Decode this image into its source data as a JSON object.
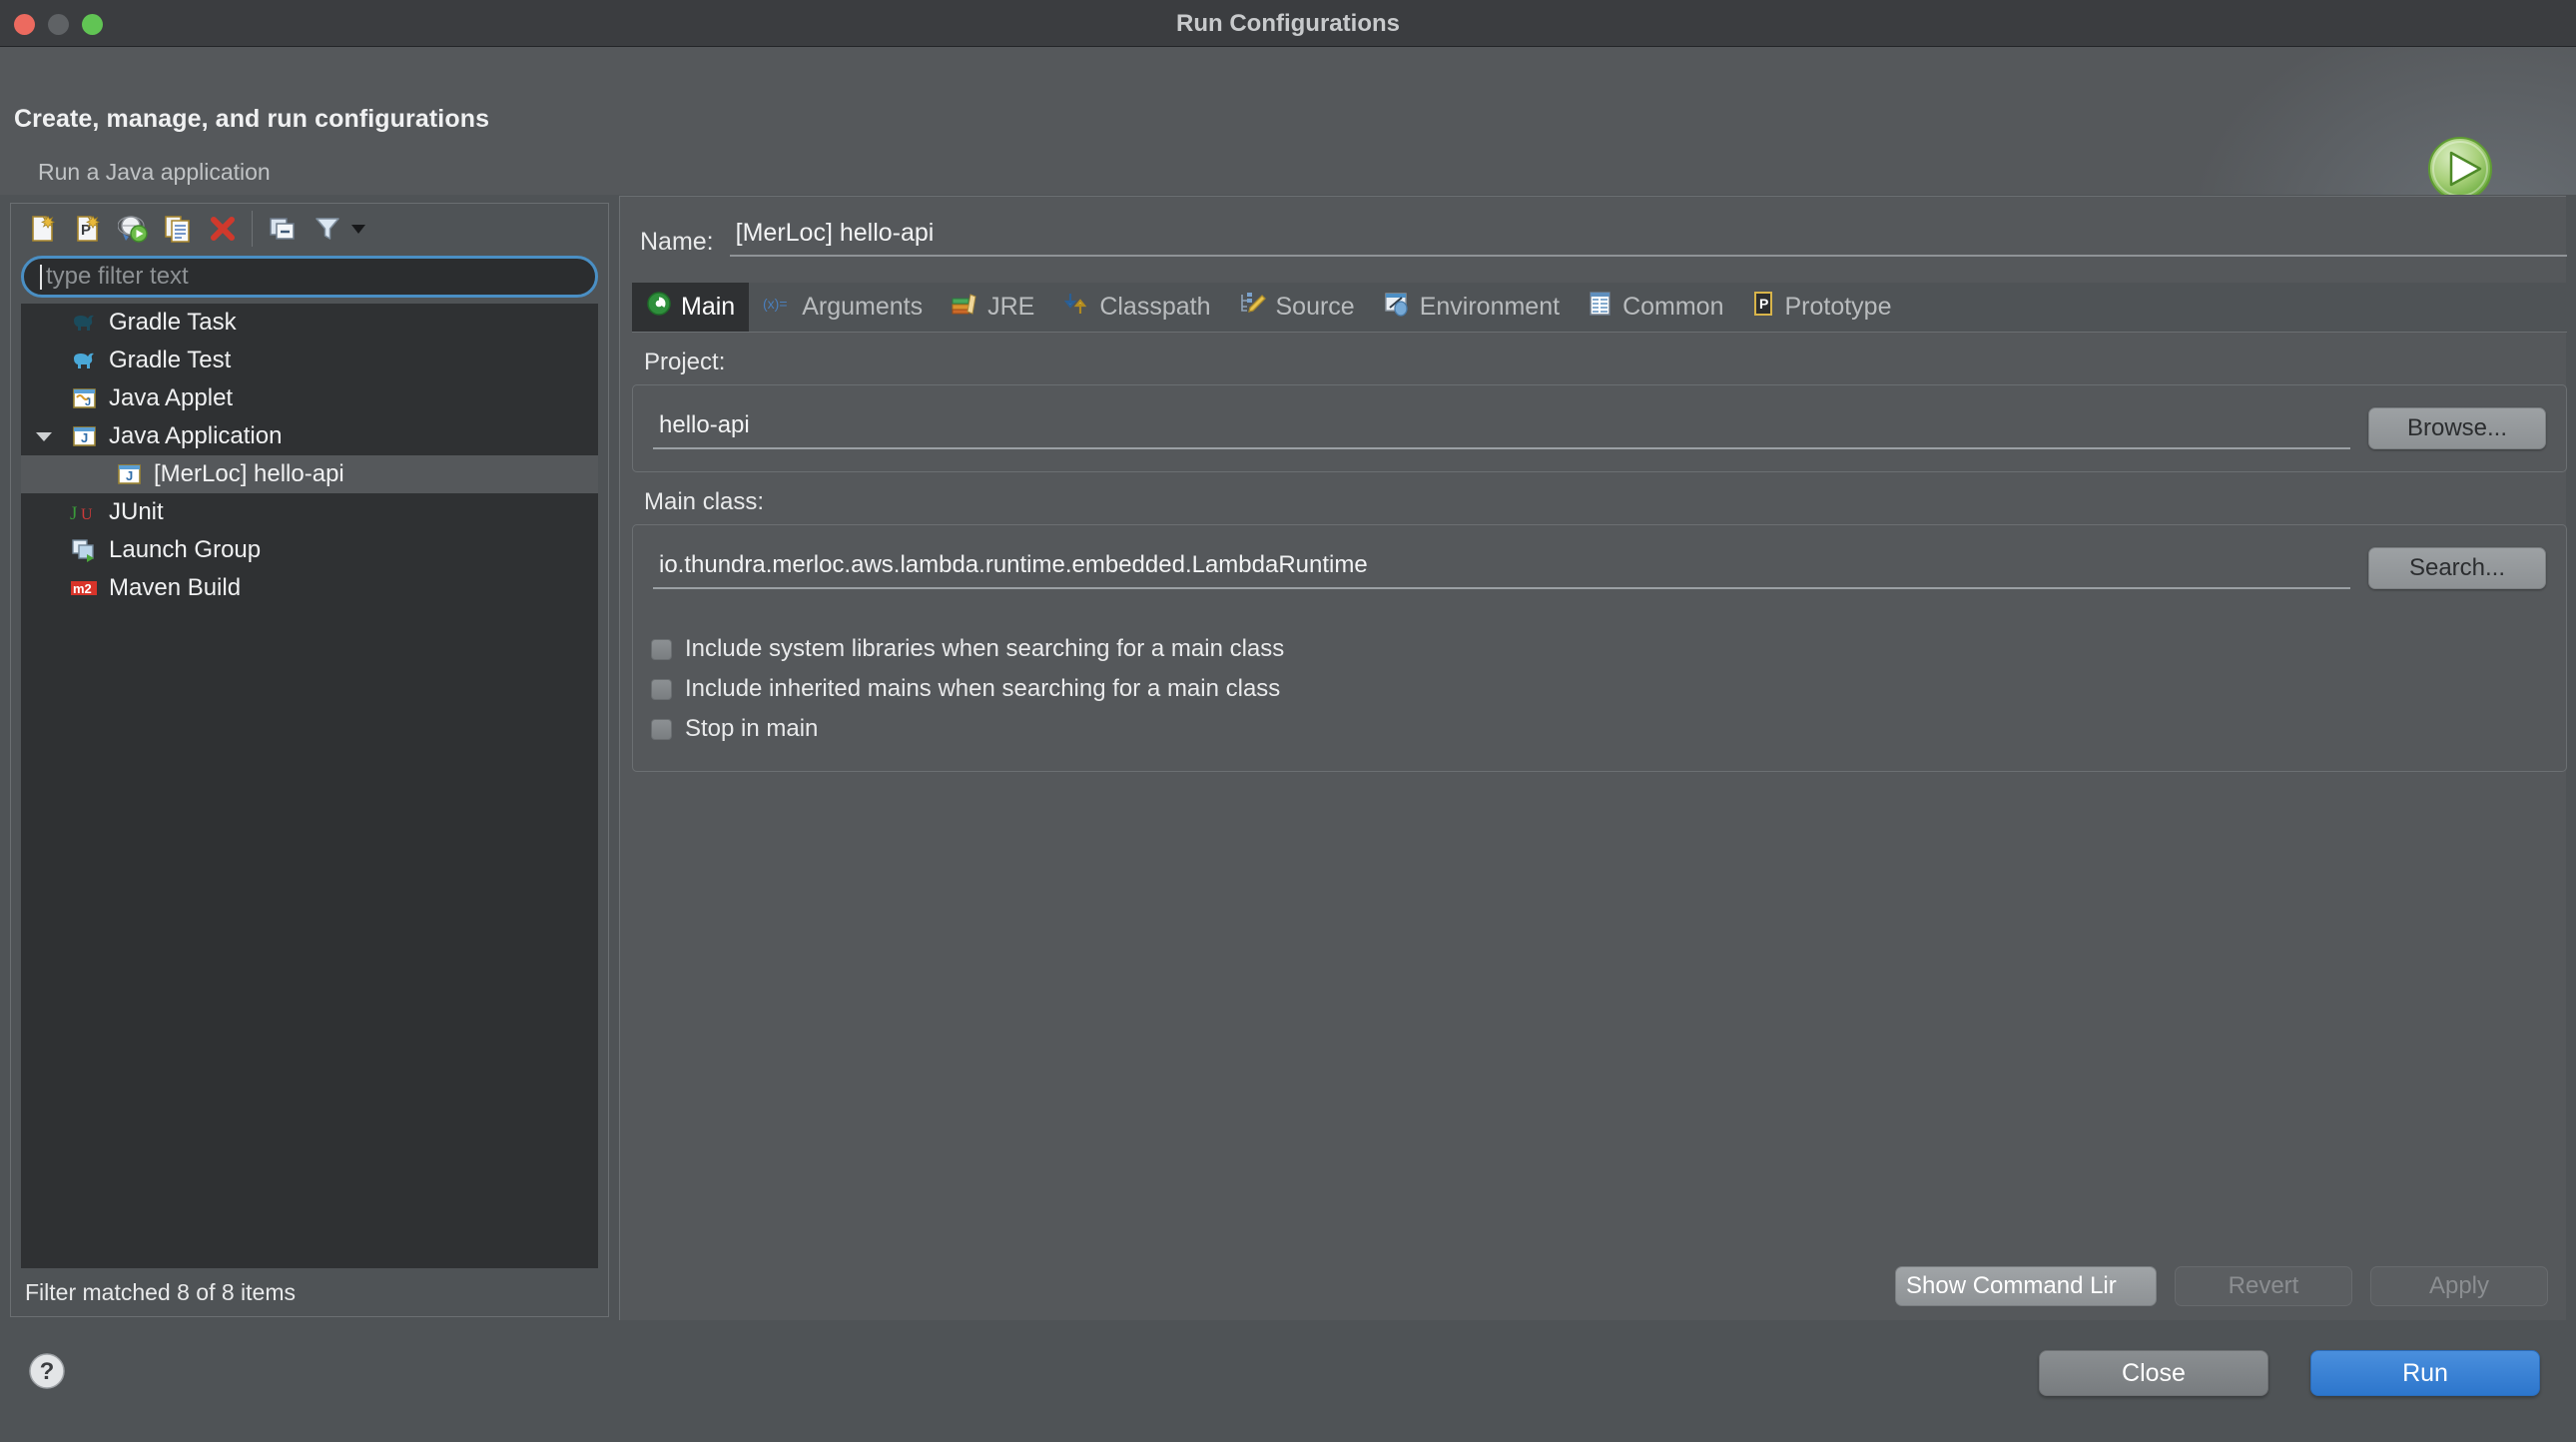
{
  "window": {
    "title": "Run Configurations",
    "traffic_lights": [
      "close",
      "minimize",
      "maximize"
    ]
  },
  "header": {
    "title": "Create, manage, and run configurations",
    "subtitle": "Run a Java application",
    "icon": "run-green-play-icon"
  },
  "left_panel": {
    "toolbar": [
      {
        "name": "new-configuration-icon",
        "tooltip": "New launch configuration"
      },
      {
        "name": "new-prototype-icon",
        "tooltip": "New prototype"
      },
      {
        "name": "export-configuration-icon",
        "tooltip": "Export"
      },
      {
        "name": "duplicate-configuration-icon",
        "tooltip": "Duplicate"
      },
      {
        "name": "delete-configuration-icon",
        "tooltip": "Delete"
      },
      {
        "name": "collapse-all-icon",
        "tooltip": "Collapse All"
      },
      {
        "name": "filter-icon",
        "tooltip": "Filter"
      }
    ],
    "filter": {
      "placeholder": "type filter text",
      "value": ""
    },
    "tree": [
      {
        "label": "Gradle Task",
        "icon": "gradle-elephant-dark-icon",
        "level": 0,
        "twisty": false,
        "selected": false
      },
      {
        "label": "Gradle Test",
        "icon": "gradle-elephant-blue-icon",
        "level": 0,
        "twisty": false,
        "selected": false
      },
      {
        "label": "Java Applet",
        "icon": "java-applet-icon",
        "level": 0,
        "twisty": false,
        "selected": false
      },
      {
        "label": "Java Application",
        "icon": "java-application-icon",
        "level": 0,
        "twisty": true,
        "selected": false
      },
      {
        "label": "[MerLoc] hello-api",
        "icon": "java-application-icon",
        "level": 1,
        "twisty": false,
        "selected": true
      },
      {
        "label": "JUnit",
        "icon": "junit-icon",
        "level": 0,
        "twisty": false,
        "selected": false
      },
      {
        "label": "Launch Group",
        "icon": "launch-group-icon",
        "level": 0,
        "twisty": false,
        "selected": false
      },
      {
        "label": "Maven Build",
        "icon": "maven-m2-icon",
        "level": 0,
        "twisty": false,
        "selected": false
      }
    ],
    "status": "Filter matched 8 of 8 items"
  },
  "right_panel": {
    "name_label": "Name:",
    "name_value": "[MerLoc] hello-api",
    "tabs": [
      {
        "label": "Main",
        "icon": "main-class-icon",
        "active": true
      },
      {
        "label": "Arguments",
        "icon": "arguments-icon",
        "active": false
      },
      {
        "label": "JRE",
        "icon": "jre-books-icon",
        "active": false
      },
      {
        "label": "Classpath",
        "icon": "classpath-icon",
        "active": false
      },
      {
        "label": "Source",
        "icon": "source-pencil-icon",
        "active": false
      },
      {
        "label": "Environment",
        "icon": "environment-icon",
        "active": false
      },
      {
        "label": "Common",
        "icon": "common-grid-icon",
        "active": false
      },
      {
        "label": "Prototype",
        "icon": "prototype-p-icon",
        "active": false
      }
    ],
    "main_tab": {
      "project_label": "Project:",
      "project_value": "hello-api",
      "browse_label": "Browse...",
      "main_class_label": "Main class:",
      "main_class_value": "io.thundra.merloc.aws.lambda.runtime.embedded.LambdaRuntime",
      "search_label": "Search...",
      "checkboxes": [
        {
          "label": "Include system libraries when searching for a main class",
          "checked": false
        },
        {
          "label": "Include inherited mains when searching for a main class",
          "checked": false
        },
        {
          "label": "Stop in main",
          "checked": false
        }
      ]
    },
    "actions": {
      "show_command_line": "Show Command Lir",
      "revert": "Revert",
      "apply": "Apply"
    }
  },
  "footer": {
    "help_icon": "help-question-icon",
    "close_label": "Close",
    "run_label": "Run"
  },
  "colors": {
    "window_bg": "#4f5356",
    "titlebar_bg": "#3b3d40",
    "tree_bg": "#2f3133",
    "accent_blue": "#2d76cc",
    "focus_ring": "#4a8fc4",
    "selection": "#55585b"
  }
}
